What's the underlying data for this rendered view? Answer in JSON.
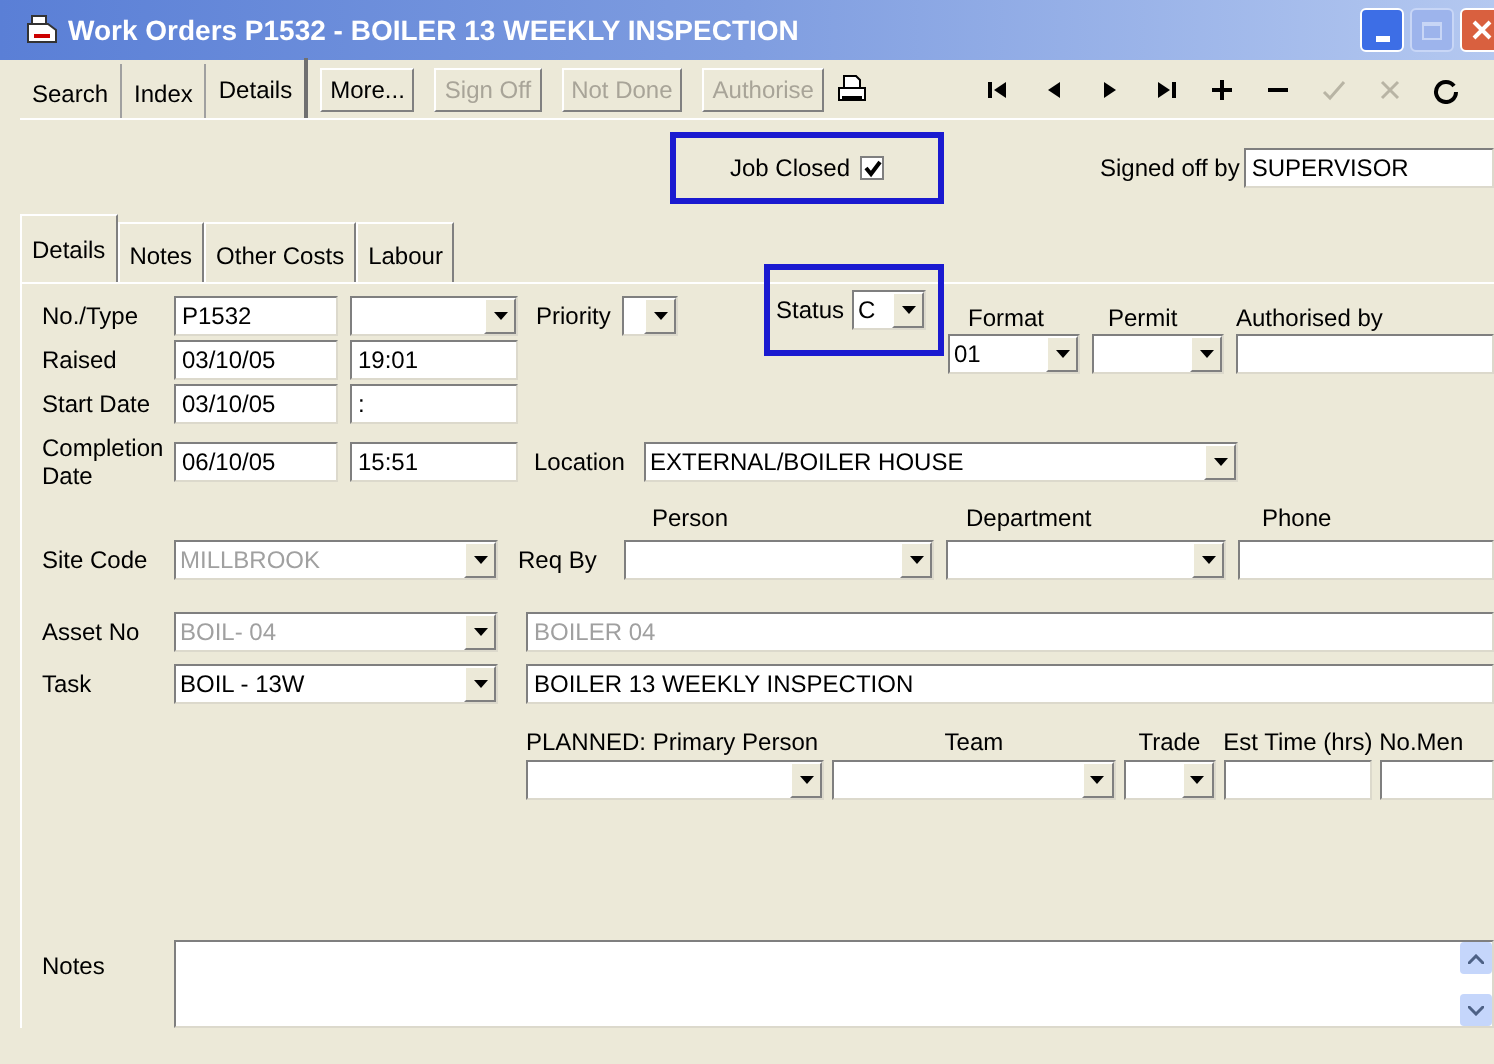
{
  "window": {
    "title": "Work Orders P1532 - BOILER 13 WEEKLY INSPECTION"
  },
  "view_tabs": [
    {
      "label": "Search",
      "selected": false
    },
    {
      "label": "Index",
      "selected": false
    },
    {
      "label": "Details",
      "selected": true
    }
  ],
  "actions": [
    {
      "label": "More...",
      "disabled": false
    },
    {
      "label": "Sign Off",
      "disabled": true
    },
    {
      "label": "Not Done",
      "disabled": true
    },
    {
      "label": "Authorise",
      "disabled": true
    }
  ],
  "nav": [
    {
      "kind": "first",
      "disabled": false
    },
    {
      "kind": "prev",
      "disabled": false
    },
    {
      "kind": "next",
      "disabled": false
    },
    {
      "kind": "last",
      "disabled": false
    },
    {
      "kind": "add",
      "disabled": false
    },
    {
      "kind": "remove",
      "disabled": false
    },
    {
      "kind": "confirm",
      "disabled": true
    },
    {
      "kind": "cancel",
      "disabled": true
    },
    {
      "kind": "refresh",
      "disabled": false
    }
  ],
  "job_closed": {
    "label": "Job Closed",
    "checked": true,
    "highlighted": true
  },
  "signed_off_by": {
    "label": "Signed off by",
    "value": "SUPERVISOR"
  },
  "form_tabs": [
    {
      "label": "Details",
      "selected": true
    },
    {
      "label": "Notes",
      "selected": false
    },
    {
      "label": "Other Costs",
      "selected": false
    },
    {
      "label": "Labour",
      "selected": false
    }
  ],
  "no_type": {
    "label": "No./Type",
    "value": "P1532"
  },
  "priority": {
    "label": "Priority"
  },
  "status": {
    "label": "Status",
    "value": "C",
    "highlighted": true
  },
  "format": {
    "label": "Format",
    "value": "01"
  },
  "permit": {
    "label": "Permit"
  },
  "authorised_by": {
    "label": "Authorised by"
  },
  "raised": {
    "label": "Raised",
    "date": "03/10/05",
    "time": "19:01"
  },
  "start_date": {
    "label": "Start Date",
    "date": "03/10/05",
    "time": ":"
  },
  "completion_date": {
    "label": "Completion Date",
    "date": "06/10/05",
    "time": "15:51"
  },
  "location": {
    "label": "Location",
    "value": "EXTERNAL/BOILER HOUSE"
  },
  "req_by": {
    "label": "Req By",
    "columns": [
      "Person",
      "Department",
      "Phone"
    ]
  },
  "site_code": {
    "label": "Site Code",
    "value": "MILLBROOK",
    "disabled": true
  },
  "asset": {
    "label": "Asset No",
    "code": "BOIL- 04",
    "description": "BOILER 04",
    "disabled": true
  },
  "task": {
    "label": "Task",
    "code": "BOIL - 13W",
    "description": "BOILER 13 WEEKLY INSPECTION",
    "disabled": false
  },
  "planned": [
    {
      "label": "PLANNED: Primary Person",
      "kind": "combo"
    },
    {
      "label": "Team",
      "kind": "combo"
    },
    {
      "label": "Trade",
      "kind": "combo"
    },
    {
      "label": "Est Time (hrs)",
      "kind": "text"
    },
    {
      "label": "No.Men",
      "kind": "text"
    }
  ],
  "notes": {
    "label": "Notes"
  }
}
